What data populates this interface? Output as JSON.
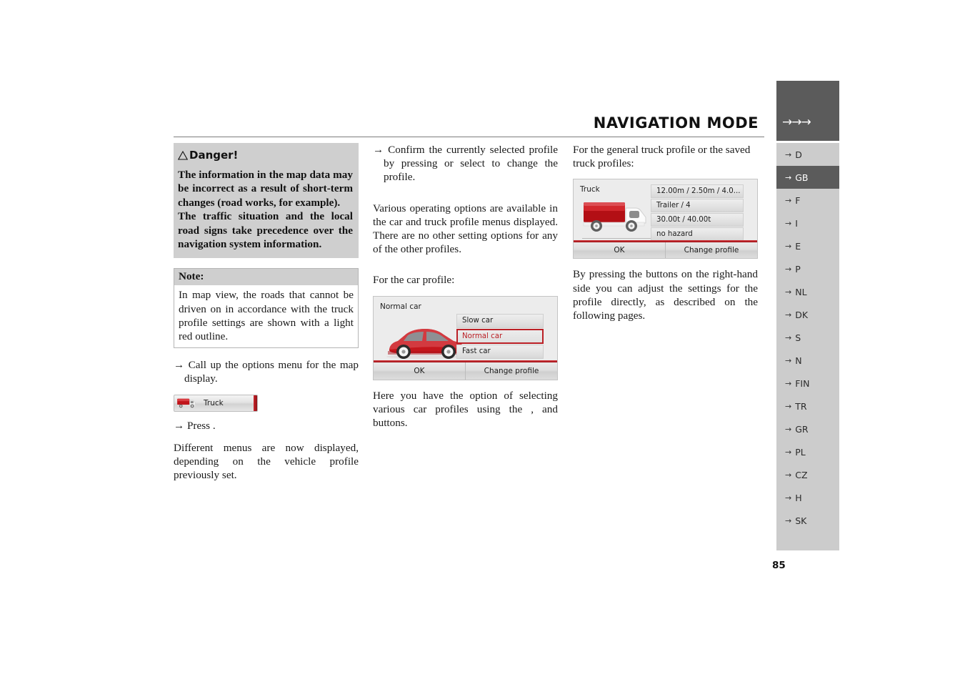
{
  "header": {
    "title": "NAVIGATION MODE",
    "arrows": "→→→"
  },
  "page_number": "85",
  "col1": {
    "danger": {
      "heading": "Danger!",
      "paragraph1": "The information in the map data may be incorrect as a result of short-term changes (road works, for example).",
      "paragraph2": "The traffic situation and the local road signs take precedence over the navigation system information."
    },
    "note": {
      "heading": "Note:",
      "body": "In map view, the roads that cannot be driven on in accordance with the truck profile settings are shown with a light red outline."
    },
    "step1": "→ Call up the options menu for the map display.",
    "truck_button_label": "Truck",
    "step2": "→ Press           .",
    "paragraph": "Different menus are now displayed, depending on the vehicle profile previously set."
  },
  "col2": {
    "step1": "→ Confirm the currently selected profile by pressing         or select           to change the profile.",
    "paragraph1": "Various operating options are available in the car and truck profile menus displayed. There are no other setting options for any of the other profiles.",
    "paragraph2": "For the car profile:",
    "car_device": {
      "title": "Normal car",
      "options": [
        "Slow car",
        "Normal car",
        "Fast car"
      ],
      "selected_option": "Normal car",
      "buttons": [
        "OK",
        "Change profile"
      ]
    },
    "paragraph3": "Here you have the option of selecting various car profiles using the                  ,                and               buttons."
  },
  "col3": {
    "paragraph1": "For the general truck profile or the saved truck profiles:",
    "truck_device": {
      "title": "Truck",
      "values": [
        "12.00m / 2.50m / 4.0...",
        "Trailer / 4",
        "30.00t / 40.00t",
        "no hazard"
      ],
      "buttons": [
        "OK",
        "Change profile"
      ]
    },
    "paragraph2": "By pressing the buttons on the right-hand side you can adjust the settings for the profile directly, as described on the following pages."
  },
  "sidebar": {
    "active": "GB",
    "items": [
      {
        "label": "D"
      },
      {
        "label": "GB"
      },
      {
        "label": "F"
      },
      {
        "label": "I"
      },
      {
        "label": "E"
      },
      {
        "label": "P"
      },
      {
        "label": "NL"
      },
      {
        "label": "DK"
      },
      {
        "label": "S"
      },
      {
        "label": "N"
      },
      {
        "label": "FIN"
      },
      {
        "label": "TR"
      },
      {
        "label": "GR"
      },
      {
        "label": "PL"
      },
      {
        "label": "CZ"
      },
      {
        "label": "H"
      },
      {
        "label": "SK"
      }
    ],
    "arrow_glyph": "→"
  },
  "colors": {
    "accent_red": "#bb2026",
    "header_dark": "#5b5b5b",
    "sidebar_bg": "#cccccc",
    "box_gray": "#cfcfcf"
  }
}
